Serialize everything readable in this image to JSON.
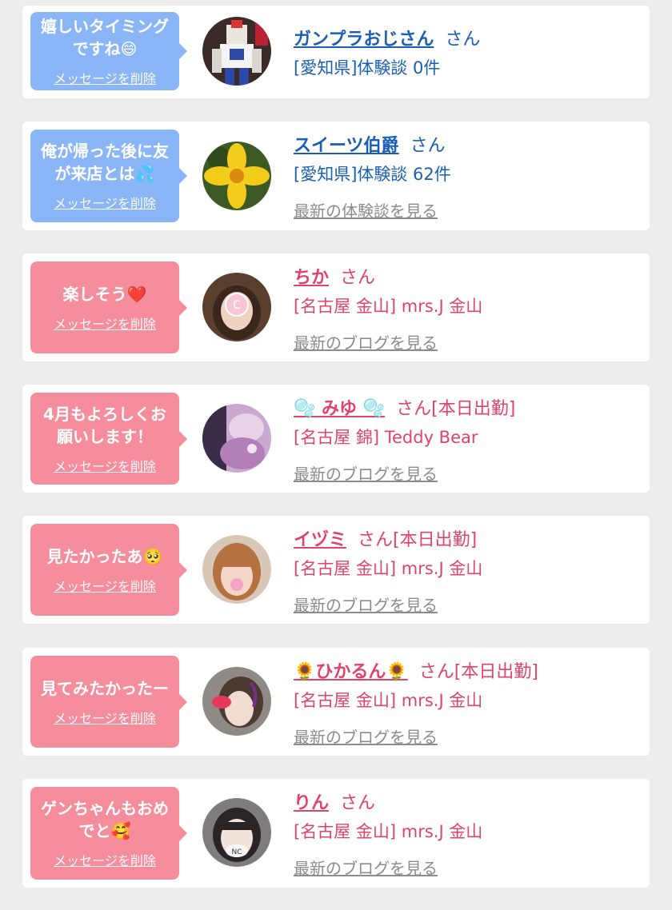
{
  "items": [
    {
      "message": "嬉しいタイミングですね😄",
      "delete_label": "メッセージを削除",
      "name": "ガンプラおじさん",
      "honorific": "さん",
      "info": "[愛知県]体験談 0件",
      "latest_link": "",
      "theme": "blue"
    },
    {
      "message": "俺が帰った後に友が来店とは💦",
      "delete_label": "メッセージを削除",
      "name": "スイーツ伯爵",
      "honorific": "さん",
      "info": "[愛知県]体験談 62件",
      "latest_link": "最新の体験談を見る",
      "theme": "blue"
    },
    {
      "message": "楽しそう❤️",
      "delete_label": "メッセージを削除",
      "name": "ちか",
      "honorific": "さん",
      "info": "[名古屋 金山] mrs.J 金山",
      "latest_link": "最新のブログを見る",
      "theme": "pink"
    },
    {
      "message": "4月もよろしくお願いします！",
      "delete_label": "メッセージを削除",
      "name": "🫧 みゆ 🫧",
      "honorific": "さん[本日出勤]",
      "info": "[名古屋 錦] Teddy Bear",
      "latest_link": "最新のブログを見る",
      "theme": "pink"
    },
    {
      "message": "見たかったあ🥺",
      "delete_label": "メッセージを削除",
      "name": "イヅミ",
      "honorific": "さん[本日出勤]",
      "info": "[名古屋 金山] mrs.J 金山",
      "latest_link": "最新のブログを見る",
      "theme": "pink"
    },
    {
      "message": "見てみたかったー",
      "delete_label": "メッセージを削除",
      "name": "🌻ひかるん🌻",
      "honorific": "さん[本日出勤]",
      "info": "[名古屋 金山] mrs.J 金山",
      "latest_link": "最新のブログを見る",
      "theme": "pink"
    },
    {
      "message": "ゲンちゃんもおめでと🥰",
      "delete_label": "メッセージを削除",
      "name": "りん",
      "honorific": "さん",
      "info": "[名古屋 金山] mrs.J 金山",
      "latest_link": "最新のブログを見る",
      "theme": "pink"
    }
  ],
  "colors": {
    "blue_bubble": "#8ab5f7",
    "pink_bubble": "#f58d9c",
    "blue_text": "#1a5fb4",
    "pink_text": "#e0436b",
    "link_gray": "#8c8c8c"
  }
}
